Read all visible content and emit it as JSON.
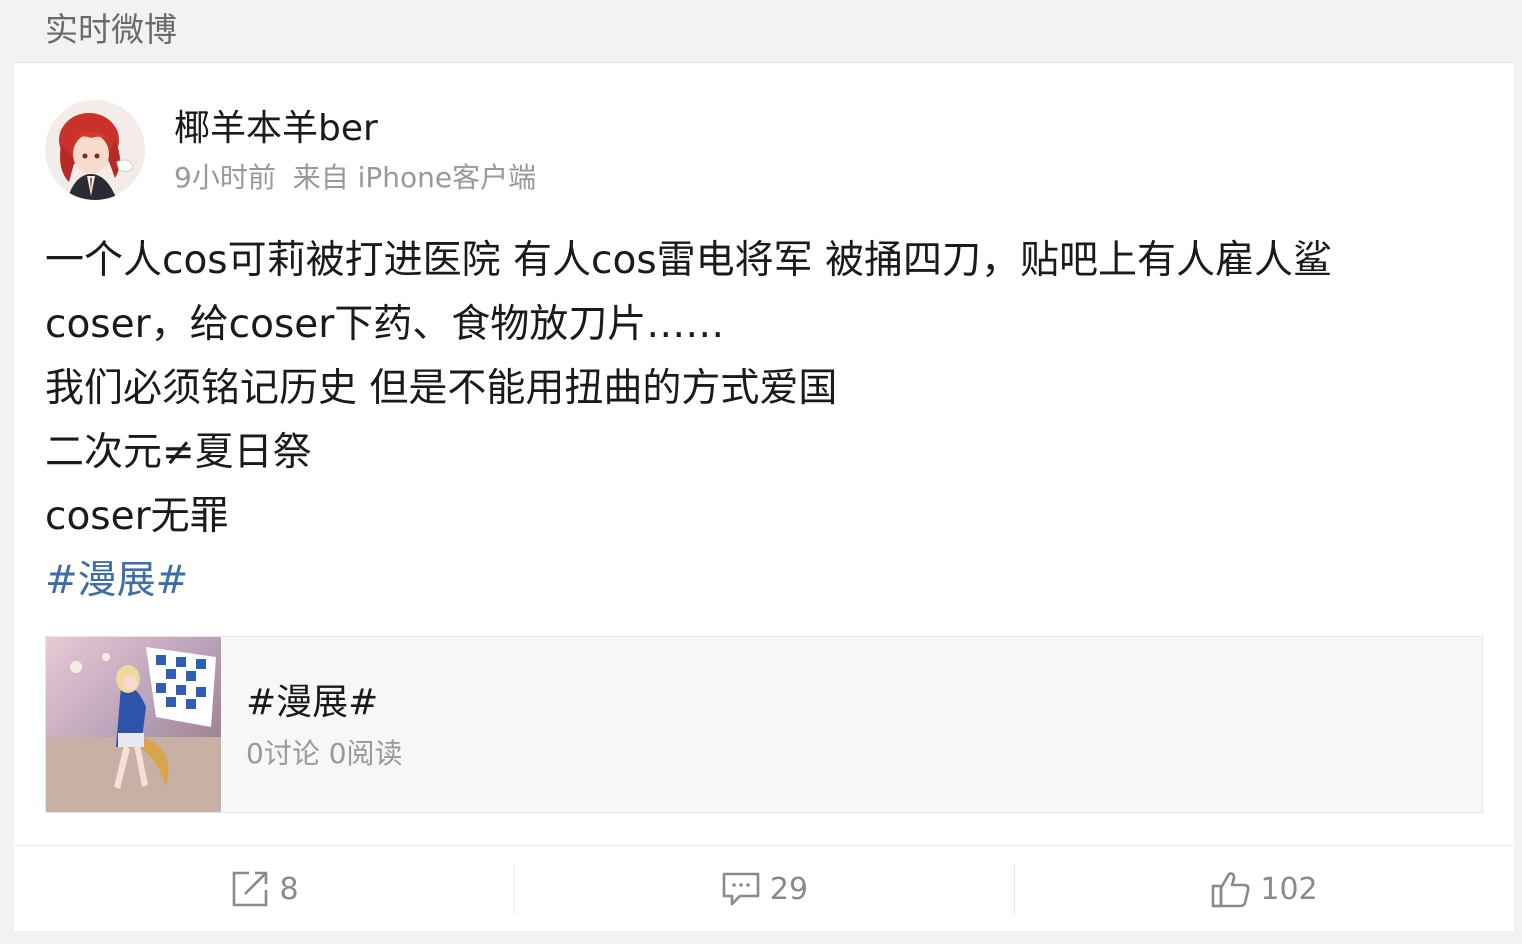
{
  "section": {
    "title": "实时微博"
  },
  "post": {
    "author": "椰羊本羊ber",
    "time": "9小时前",
    "source": "来自 iPhone客户端",
    "lines": [
      "一个人cos可莉被打进医院 有人cos雷电将军 被捅四刀，贴吧上有人雇人鲨",
      "coser，给coser下药、食物放刀片……",
      "我们必须铭记历史 但是不能用扭曲的方式爱国",
      "二次元≠夏日祭",
      "coser无罪"
    ],
    "hashtag": "#漫展#"
  },
  "topic_card": {
    "title": "#漫展#",
    "stats": "0讨论 0阅读"
  },
  "actions": {
    "repost_count": "8",
    "comment_count": "29",
    "like_count": "102"
  },
  "colors": {
    "link": "#3f6ea6",
    "muted": "#999999",
    "text": "#1a1a1a",
    "background": "#f2f2f2"
  },
  "icons": {
    "repost": "edit-share-icon",
    "comment": "comment-bubble-icon",
    "like": "thumbs-up-icon"
  }
}
